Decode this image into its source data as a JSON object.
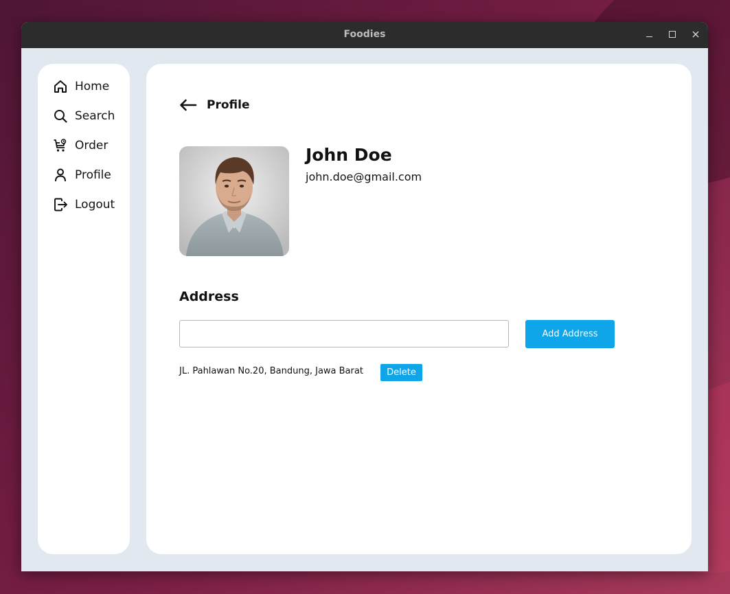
{
  "window": {
    "title": "Foodies"
  },
  "sidebar": {
    "items": [
      {
        "label": "Home",
        "icon": "home-icon"
      },
      {
        "label": "Search",
        "icon": "search-icon"
      },
      {
        "label": "Order",
        "icon": "cart-icon"
      },
      {
        "label": "Profile",
        "icon": "user-icon"
      },
      {
        "label": "Logout",
        "icon": "logout-icon"
      }
    ]
  },
  "header": {
    "back_icon": "arrow-left-icon",
    "title": "Profile"
  },
  "profile": {
    "name": "John Doe",
    "email": "john.doe@gmail.com"
  },
  "address": {
    "section_title": "Address",
    "input_value": "",
    "input_placeholder": "",
    "add_label": "Add Address",
    "items": [
      {
        "text": "JL. Pahlawan No.20, Bandung, Jawa Barat",
        "delete_label": "Delete"
      }
    ]
  },
  "colors": {
    "accent": "#0ea5e9",
    "window_background": "#e2e8f0",
    "panel_background": "#ffffff",
    "titlebar": "#2c2c2c"
  }
}
